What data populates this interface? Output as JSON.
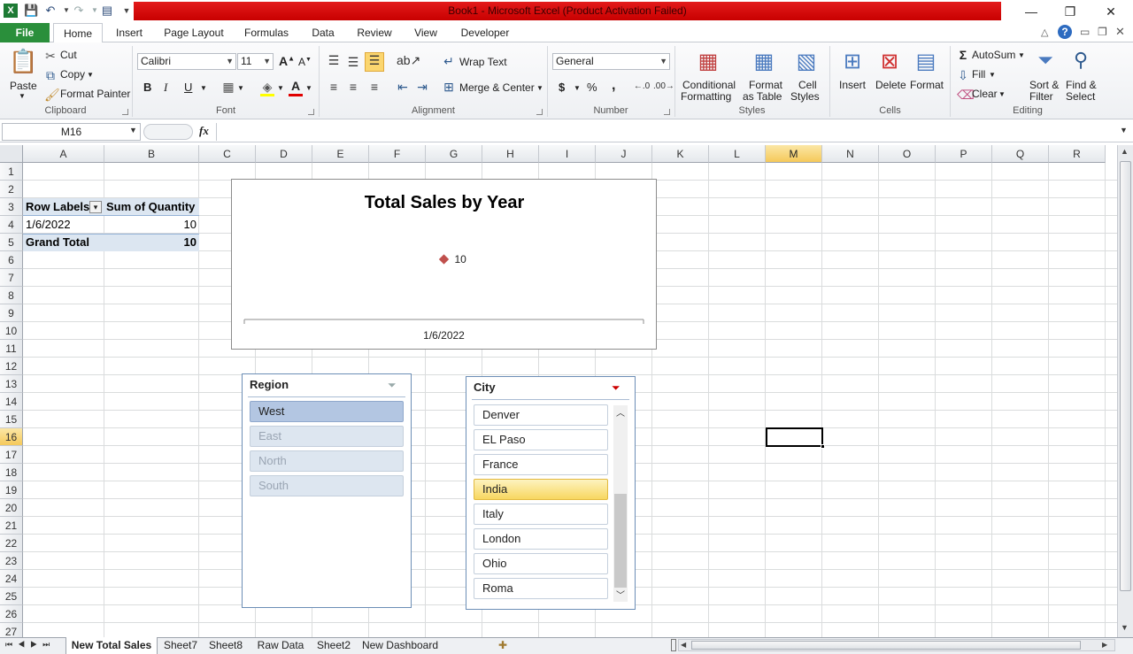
{
  "window": {
    "title": "Book1 - Microsoft Excel (Product Activation Failed)",
    "min_glyph": "—",
    "restore_glyph": "❐",
    "close_glyph": "✕"
  },
  "qat": {
    "save_icon": "save-icon",
    "undo_icon": "undo-icon",
    "redo_icon": "redo-icon"
  },
  "ribbon_tabs": [
    "File",
    "Home",
    "Insert",
    "Page Layout",
    "Formulas",
    "Data",
    "Review",
    "View",
    "Developer"
  ],
  "clipboard": {
    "paste": "Paste",
    "cut": "Cut",
    "copy": "Copy",
    "format_painter": "Format Painter",
    "label": "Clipboard"
  },
  "font": {
    "name": "Calibri",
    "size": "11",
    "label": "Font",
    "bold": "B",
    "italic": "I",
    "underline": "U"
  },
  "alignment": {
    "wrap_text": "Wrap Text",
    "merge_center": "Merge & Center",
    "label": "Alignment"
  },
  "number": {
    "format": "General",
    "label": "Number",
    "currency": "$",
    "percent": "%",
    "comma": ","
  },
  "styles": {
    "conditional": "Conditional",
    "conditional2": "Formatting",
    "format_as": "Format",
    "format_as2": "as Table",
    "cell": "Cell",
    "cell2": "Styles",
    "label": "Styles"
  },
  "cells": {
    "insert": "Insert",
    "delete": "Delete",
    "format": "Format",
    "label": "Cells"
  },
  "editing": {
    "autosum": "AutoSum",
    "fill": "Fill",
    "clear": "Clear",
    "sort": "Sort &",
    "sort2": "Filter",
    "find": "Find &",
    "find2": "Select",
    "label": "Editing"
  },
  "formula_bar": {
    "name_box": "M16",
    "fx": "fx",
    "content": ""
  },
  "columns": [
    "A",
    "B",
    "C",
    "D",
    "E",
    "F",
    "G",
    "H",
    "I",
    "J",
    "K",
    "L",
    "M",
    "N",
    "O",
    "P",
    "Q",
    "R"
  ],
  "selected_column": "M",
  "rows": [
    "1",
    "2",
    "3",
    "4",
    "5",
    "6",
    "7",
    "8",
    "9",
    "10",
    "11",
    "12",
    "13",
    "14",
    "15",
    "16",
    "17",
    "18",
    "19",
    "20",
    "21",
    "22",
    "23",
    "24",
    "25",
    "26",
    "27"
  ],
  "selected_row": "16",
  "pivot": {
    "row_labels": "Row Labels",
    "sum_of_quantity": "Sum of Quantity",
    "rows": [
      {
        "label": "1/6/2022",
        "value": "10"
      }
    ],
    "grand_total_label": "Grand Total",
    "grand_total_value": "10"
  },
  "chart_data": {
    "type": "line",
    "title": "Total Sales by Year",
    "categories": [
      "1/6/2022"
    ],
    "series": [
      {
        "values": [
          10
        ]
      }
    ],
    "data_labels": [
      "10"
    ],
    "marker_color": "#c0504d"
  },
  "region_slicer": {
    "title": "Region",
    "items": [
      {
        "label": "West",
        "state": "selected"
      },
      {
        "label": "East",
        "state": "nodata"
      },
      {
        "label": "North",
        "state": "nodata"
      },
      {
        "label": "South",
        "state": "nodata"
      }
    ]
  },
  "city_slicer": {
    "title": "City",
    "items": [
      {
        "label": "Denver",
        "state": "normal"
      },
      {
        "label": "EL Paso",
        "state": "normal"
      },
      {
        "label": "France",
        "state": "normal"
      },
      {
        "label": "India",
        "state": "selected"
      },
      {
        "label": "Italy",
        "state": "normal"
      },
      {
        "label": "London",
        "state": "normal"
      },
      {
        "label": "Ohio",
        "state": "normal"
      },
      {
        "label": "Roma",
        "state": "normal"
      }
    ]
  },
  "sheets": [
    "New Total Sales",
    "Sheet7",
    "Sheet8",
    "Raw Data",
    "Sheet2",
    "New Dashboard"
  ],
  "active_sheet": "New Total Sales"
}
